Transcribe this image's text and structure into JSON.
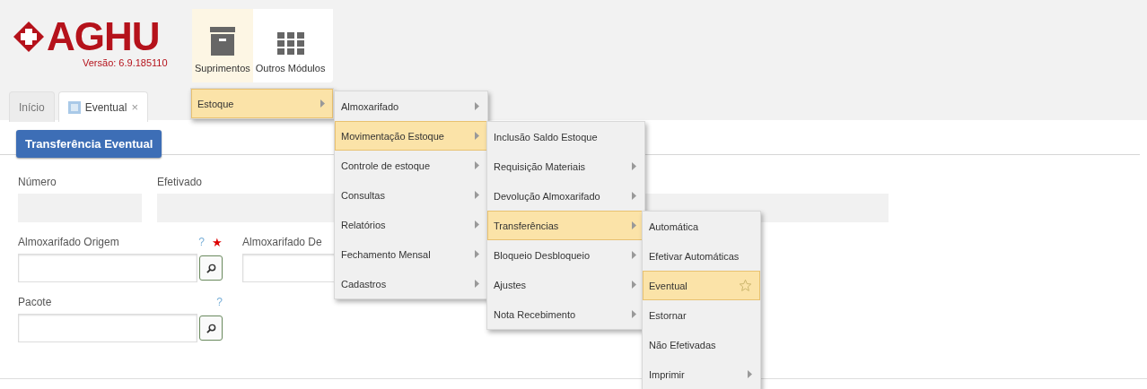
{
  "logo": {
    "name": "AGHU",
    "version": "Versão: 6.9.185110"
  },
  "modules": [
    {
      "label": "Suprimentos",
      "kind": "box",
      "selected": true
    },
    {
      "label": "Outros Módulos",
      "kind": "grid",
      "selected": false
    }
  ],
  "tabs": [
    {
      "label": "Início",
      "selected": false
    },
    {
      "label": "Eventual",
      "selected": true,
      "close": "×"
    }
  ],
  "page_title": "Transferência Eventual",
  "fields": [
    {
      "label": "Número",
      "lookup": false,
      "kind": "small"
    },
    {
      "label": "Efetivado",
      "lookup": false,
      "kind": "wide"
    },
    {
      "label": "Almoxarifado Origem",
      "help": "?",
      "required": "★",
      "lookup": true,
      "kind": "lookup"
    },
    {
      "label": "Almoxarifado De",
      "lookup": false,
      "kind": "covered"
    },
    {
      "label": "Pacote",
      "help": "?",
      "lookup": true,
      "kind": "lookup"
    }
  ],
  "menu": [
    {
      "label": "Estoque",
      "selected": true,
      "arrow": true,
      "children": [
        {
          "label": "Almoxarifado",
          "selected": false,
          "arrow": true
        },
        {
          "label": "Movimentação Estoque",
          "selected": true,
          "arrow": true,
          "children": [
            {
              "label": "Inclusão Saldo Estoque",
              "selected": false,
              "arrow": false
            },
            {
              "label": "Requisição Materiais",
              "selected": false,
              "arrow": true
            },
            {
              "label": "Devolução Almoxarifado",
              "selected": false,
              "arrow": true
            },
            {
              "label": "Transferências",
              "selected": true,
              "arrow": true,
              "children": [
                {
                  "label": "Automática",
                  "selected": false,
                  "arrow": false
                },
                {
                  "label": "Efetivar Automáticas",
                  "selected": false,
                  "arrow": false
                },
                {
                  "label": "Eventual",
                  "selected": true,
                  "arrow": false
                },
                {
                  "label": "Estornar",
                  "selected": false,
                  "arrow": false
                },
                {
                  "label": "Não Efetivadas",
                  "selected": false,
                  "arrow": false
                },
                {
                  "label": "Imprimir",
                  "selected": false,
                  "arrow": true
                }
              ]
            },
            {
              "label": "Bloqueio Desbloqueio",
              "selected": false,
              "arrow": true
            },
            {
              "label": "Ajustes",
              "selected": false,
              "arrow": true
            },
            {
              "label": "Nota Recebimento",
              "selected": false,
              "arrow": true
            }
          ]
        },
        {
          "label": "Controle de estoque",
          "selected": false,
          "arrow": true
        },
        {
          "label": "Consultas",
          "selected": false,
          "arrow": true
        },
        {
          "label": "Relatórios",
          "selected": false,
          "arrow": true
        },
        {
          "label": "Fechamento Mensal",
          "selected": false,
          "arrow": true
        },
        {
          "label": "Cadastros",
          "selected": false,
          "arrow": true
        }
      ]
    }
  ]
}
